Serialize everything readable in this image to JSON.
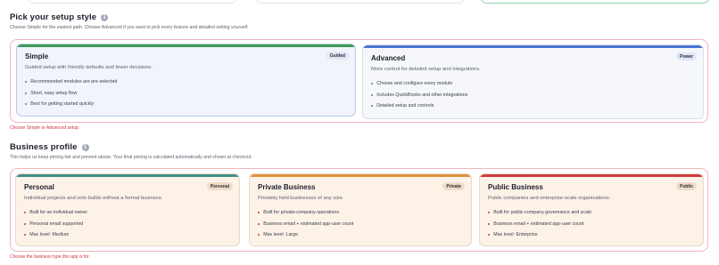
{
  "setup": {
    "title": "Pick your setup style",
    "subtitle": "Choose Simple for the easiest path. Choose Advanced if you want to pick every feature and detailed setting yourself.",
    "error": "Choose Simple or Advanced setup.",
    "options": [
      {
        "title": "Simple",
        "badge": "Guided",
        "description": "Guided setup with friendly defaults and fewer decisions.",
        "features": [
          "Recommended modules are pre-selected",
          "Short, easy setup flow",
          "Best for getting started quickly"
        ]
      },
      {
        "title": "Advanced",
        "badge": "Power",
        "description": "More control for detailed setup and integrations.",
        "features": [
          "Choose and configure every module",
          "Includes QuickBooks and other integrations",
          "Detailed setup and controls"
        ]
      }
    ]
  },
  "business": {
    "title": "Business profile",
    "subtitle": "This helps us keep pricing fair and prevent abuse. Your final pricing is calculated automatically and shown at checkout.",
    "error": "Choose the business type this app is for.",
    "options": [
      {
        "title": "Personal",
        "badge": "Personal",
        "description": "Individual projects and solo builds without a formal business.",
        "features": [
          "Built for an individual owner",
          "Personal email supported",
          "Max level: Medium"
        ]
      },
      {
        "title": "Private Business",
        "badge": "Private",
        "description": "Privately held businesses of any size.",
        "features": [
          "Built for private-company operations",
          "Business email + estimated app-user count",
          "Max level: Large"
        ]
      },
      {
        "title": "Public Business",
        "badge": "Public",
        "description": "Public companies and enterprise-scale organizations.",
        "features": [
          "Built for public-company governance and scale",
          "Business email + estimated app-user count",
          "Max level: Enterprise"
        ]
      }
    ]
  },
  "icons": {
    "info": "info-icon"
  },
  "colors": {
    "error": "#d0343c",
    "simple_accent": "#3c9a57",
    "advanced_accent": "#4a76d6",
    "personal_accent": "#3e8f86",
    "private_accent": "#e0923a",
    "public_accent": "#cf3d3d"
  }
}
